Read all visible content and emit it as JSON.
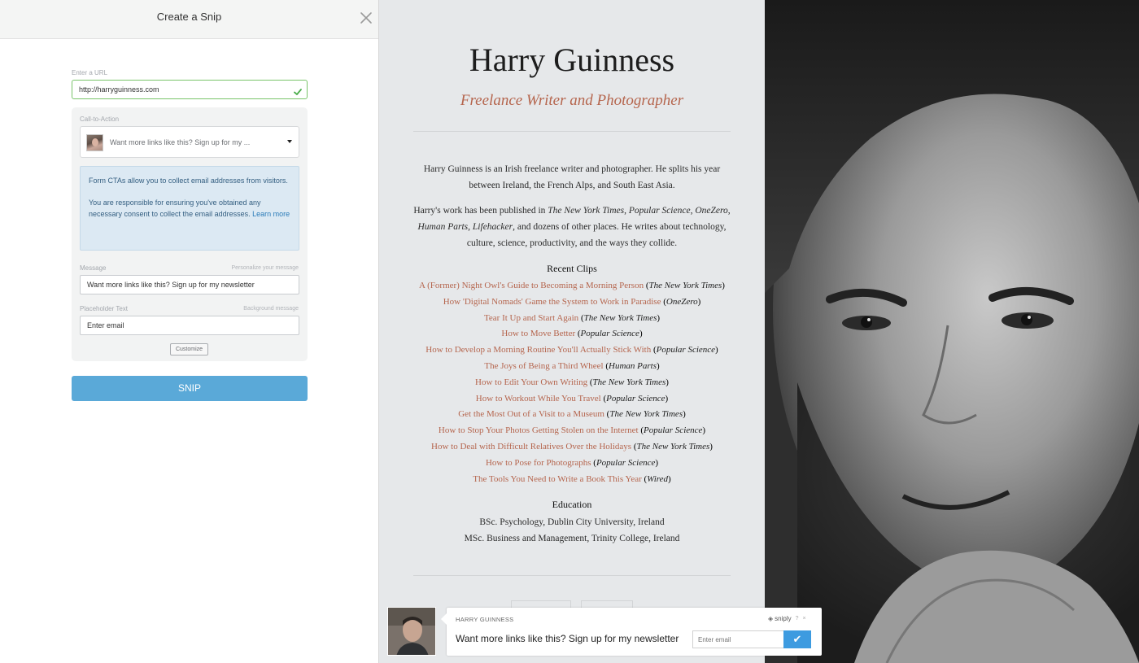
{
  "panel": {
    "title": "Create a Snip",
    "url_label": "Enter a URL",
    "url_value": "http://harryguinness.com",
    "cta_label": "Call-to-Action",
    "cta_selected": "Want more links like this? Sign up for my ...",
    "info_p1": "Form CTAs allow you to collect email addresses from visitors.",
    "info_p2_text": "You are responsible for ensuring you've obtained any necessary consent to collect the email addresses. ",
    "info_p2_link": "Learn more",
    "message_label": "Message",
    "message_hint": "Personalize your message",
    "message_value": "Want more links like this? Sign up for my newsletter",
    "placeholder_label": "Placeholder Text",
    "placeholder_hint": "Background message",
    "placeholder_value": "Enter email",
    "customize_label": "Customize",
    "snip_label": "SNIP"
  },
  "site": {
    "name": "Harry Guinness",
    "tagline": "Freelance Writer and Photographer",
    "bio1": "Harry Guinness is an Irish freelance writer and photographer. He splits his year between Ireland, the French Alps, and South East Asia.",
    "bio2_a": "Harry's work has been published in ",
    "bio2_p1": "The New York Times",
    "bio2_sep1": ", ",
    "bio2_p2": "Popular Science",
    "bio2_sep2": ", ",
    "bio2_p3": "OneZero",
    "bio2_sep3": ", ",
    "bio2_p4": "Human Parts",
    "bio2_sep4": ", ",
    "bio2_p5": "Lifehacker",
    "bio2_b": ", and dozens of other places. He writes about technology, culture, science, productivity, and the ways they collide.",
    "clips_heading": "Recent Clips",
    "clips": [
      {
        "title": "A (Former) Night Owl's Guide to Becoming a Morning Person",
        "pub": "The New York Times"
      },
      {
        "title": "How 'Digital Nomads' Game the System to Work in Paradise",
        "pub": "OneZero"
      },
      {
        "title": "Tear It Up and Start Again",
        "pub": "The New York Times"
      },
      {
        "title": "How to Move Better",
        "pub": "Popular Science"
      },
      {
        "title": "How to Develop a Morning Routine You'll Actually Stick With",
        "pub": "Popular Science"
      },
      {
        "title": "The Joys of Being a Third Wheel",
        "pub": "Human Parts"
      },
      {
        "title": "How to Edit Your Own Writing",
        "pub": "The New York Times"
      },
      {
        "title": "How to Workout While You Travel",
        "pub": "Popular Science"
      },
      {
        "title": "Get the Most Out of a Visit to a Museum",
        "pub": "The New York Times"
      },
      {
        "title": "How to Stop Your Photos Getting Stolen on the Internet",
        "pub": "Popular Science"
      },
      {
        "title": "How to Deal with Difficult Relatives Over the Holidays",
        "pub": "The New York Times"
      },
      {
        "title": "How to Pose for Photographs",
        "pub": "Popular Science"
      },
      {
        "title": "The Tools You Need to Write a Book This Year",
        "pub": "Wired"
      }
    ],
    "education_heading": "Education",
    "education": [
      "BSc. Psychology, Dublin City University, Ireland",
      "MSc. Business and Management, Trinity College, Ireland"
    ]
  },
  "widget": {
    "name": "HARRY GUINNESS",
    "brand": "sniply",
    "help": "?",
    "close": "×",
    "message": "Want more links like this? Sign up for my newsletter",
    "email_placeholder": "Enter email",
    "submit": "✔"
  }
}
